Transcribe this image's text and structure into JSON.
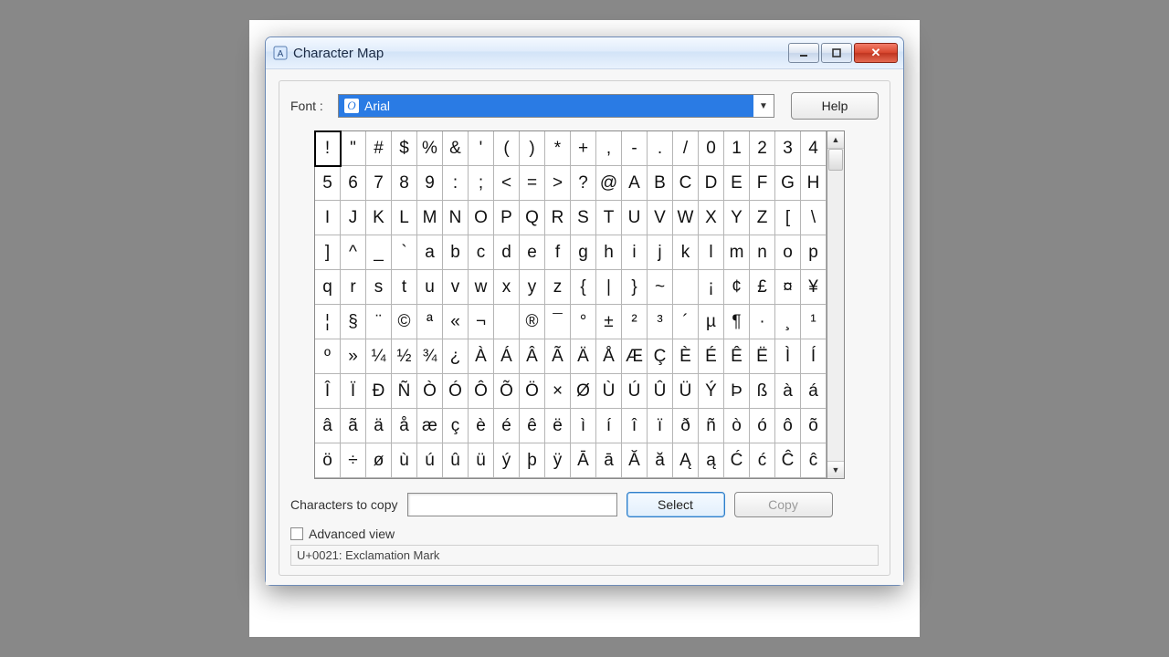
{
  "window": {
    "title": "Character Map"
  },
  "font": {
    "label": "Font :",
    "selected": "Arial"
  },
  "buttons": {
    "help": "Help",
    "select": "Select",
    "copy": "Copy"
  },
  "copy": {
    "label": "Characters to copy",
    "value": ""
  },
  "advanced": {
    "label": "Advanced view",
    "checked": false
  },
  "status": "U+0021: Exclamation Mark",
  "columns": 20,
  "selected_index": 0,
  "characters": [
    "!",
    "\"",
    "#",
    "$",
    "%",
    "&",
    "'",
    "(",
    ")",
    "*",
    "+",
    ",",
    "-",
    ".",
    "/",
    "0",
    "1",
    "2",
    "3",
    "4",
    "5",
    "6",
    "7",
    "8",
    "9",
    ":",
    ";",
    "<",
    "=",
    ">",
    "?",
    "@",
    "A",
    "B",
    "C",
    "D",
    "E",
    "F",
    "G",
    "H",
    "I",
    "J",
    "K",
    "L",
    "M",
    "N",
    "O",
    "P",
    "Q",
    "R",
    "S",
    "T",
    "U",
    "V",
    "W",
    "X",
    "Y",
    "Z",
    "[",
    "\\",
    "]",
    "^",
    "_",
    "`",
    "a",
    "b",
    "c",
    "d",
    "e",
    "f",
    "g",
    "h",
    "i",
    "j",
    "k",
    "l",
    "m",
    "n",
    "o",
    "p",
    "q",
    "r",
    "s",
    "t",
    "u",
    "v",
    "w",
    "x",
    "y",
    "z",
    "{",
    "|",
    "}",
    "~",
    " ",
    "¡",
    "¢",
    "£",
    "¤",
    "¥",
    "¦",
    "§",
    "¨",
    "©",
    "ª",
    "«",
    "¬",
    "­",
    "®",
    "¯",
    "°",
    "±",
    "²",
    "³",
    "´",
    "µ",
    "¶",
    "·",
    "¸",
    "¹",
    "º",
    "»",
    "¼",
    "½",
    "¾",
    "¿",
    "À",
    "Á",
    "Â",
    "Ã",
    "Ä",
    "Å",
    "Æ",
    "Ç",
    "È",
    "É",
    "Ê",
    "Ë",
    "Ì",
    "Í",
    "Î",
    "Ï",
    "Ð",
    "Ñ",
    "Ò",
    "Ó",
    "Ô",
    "Õ",
    "Ö",
    "×",
    "Ø",
    "Ù",
    "Ú",
    "Û",
    "Ü",
    "Ý",
    "Þ",
    "ß",
    "à",
    "á",
    "â",
    "ã",
    "ä",
    "å",
    "æ",
    "ç",
    "è",
    "é",
    "ê",
    "ë",
    "ì",
    "í",
    "î",
    "ï",
    "ð",
    "ñ",
    "ò",
    "ó",
    "ô",
    "õ",
    "ö",
    "÷",
    "ø",
    "ù",
    "ú",
    "û",
    "ü",
    "ý",
    "þ",
    "ÿ",
    "Ā",
    "ā",
    "Ă",
    "ă",
    "Ą",
    "ą",
    "Ć",
    "ć",
    "Ĉ",
    "ĉ"
  ]
}
